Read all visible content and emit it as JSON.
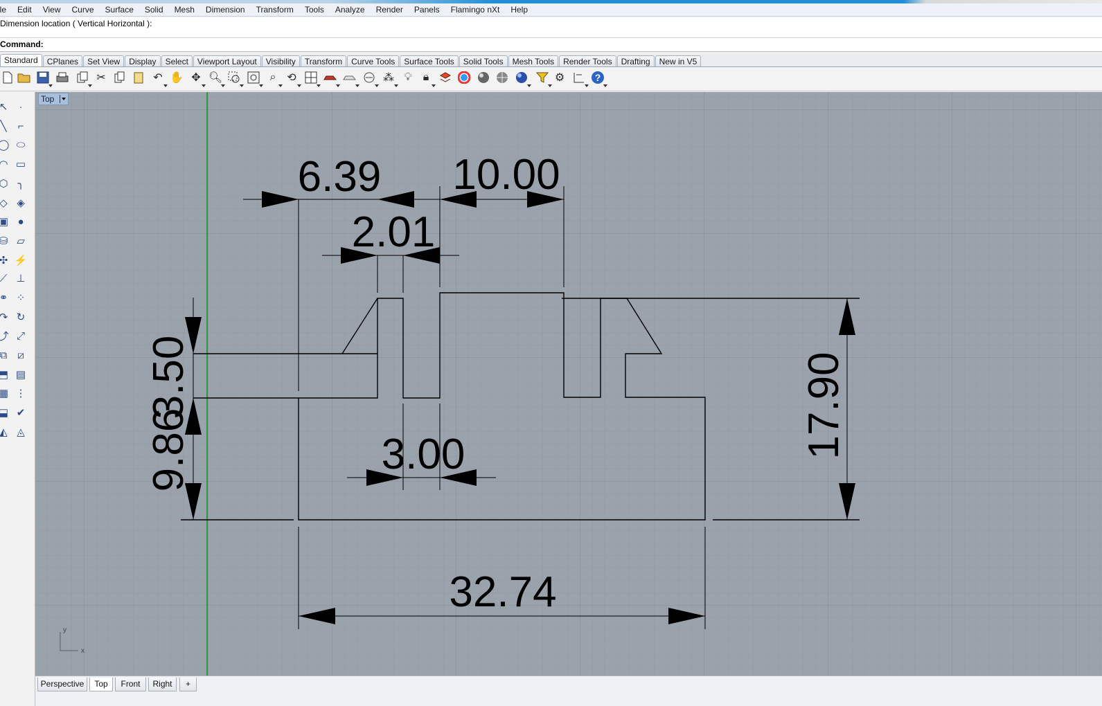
{
  "menu": [
    "ile",
    "Edit",
    "View",
    "Curve",
    "Surface",
    "Solid",
    "Mesh",
    "Dimension",
    "Transform",
    "Tools",
    "Analyze",
    "Render",
    "Panels",
    "Flamingo nXt",
    "Help"
  ],
  "command_history": "Dimension location ( Vertical  Horizontal ):",
  "command_prompt": "Command:",
  "toolbar_tabs": [
    {
      "label": "Standard",
      "active": true
    },
    {
      "label": "CPlanes"
    },
    {
      "label": "Set View"
    },
    {
      "label": "Display"
    },
    {
      "label": "Select"
    },
    {
      "label": "Viewport Layout"
    },
    {
      "label": "Visibility"
    },
    {
      "label": "Transform"
    },
    {
      "label": "Curve Tools"
    },
    {
      "label": "Surface Tools"
    },
    {
      "label": "Solid Tools"
    },
    {
      "label": "Mesh Tools"
    },
    {
      "label": "Render Tools"
    },
    {
      "label": "Drafting"
    },
    {
      "label": "New in V5"
    }
  ],
  "viewport": {
    "title": "Top",
    "axis_y": "y",
    "axis_x": "x",
    "dimensions": {
      "d1": "6.39",
      "d2": "10.00",
      "d3": "2.01",
      "d4": "9.86",
      "d5": "3.50",
      "d6": "3.00",
      "d7": "17.90",
      "d8": "32.74"
    }
  },
  "viewport_tabs": [
    {
      "label": "Perspective"
    },
    {
      "label": "Top",
      "active": true
    },
    {
      "label": "Front"
    },
    {
      "label": "Right"
    },
    {
      "label": "+"
    }
  ],
  "colors": {
    "viewport_bg": "#9aa2ac",
    "grid_major": "#8a929c",
    "grid_minor": "#939ba5",
    "y_axis": "#2e9a3a",
    "geometry": "#000000"
  }
}
